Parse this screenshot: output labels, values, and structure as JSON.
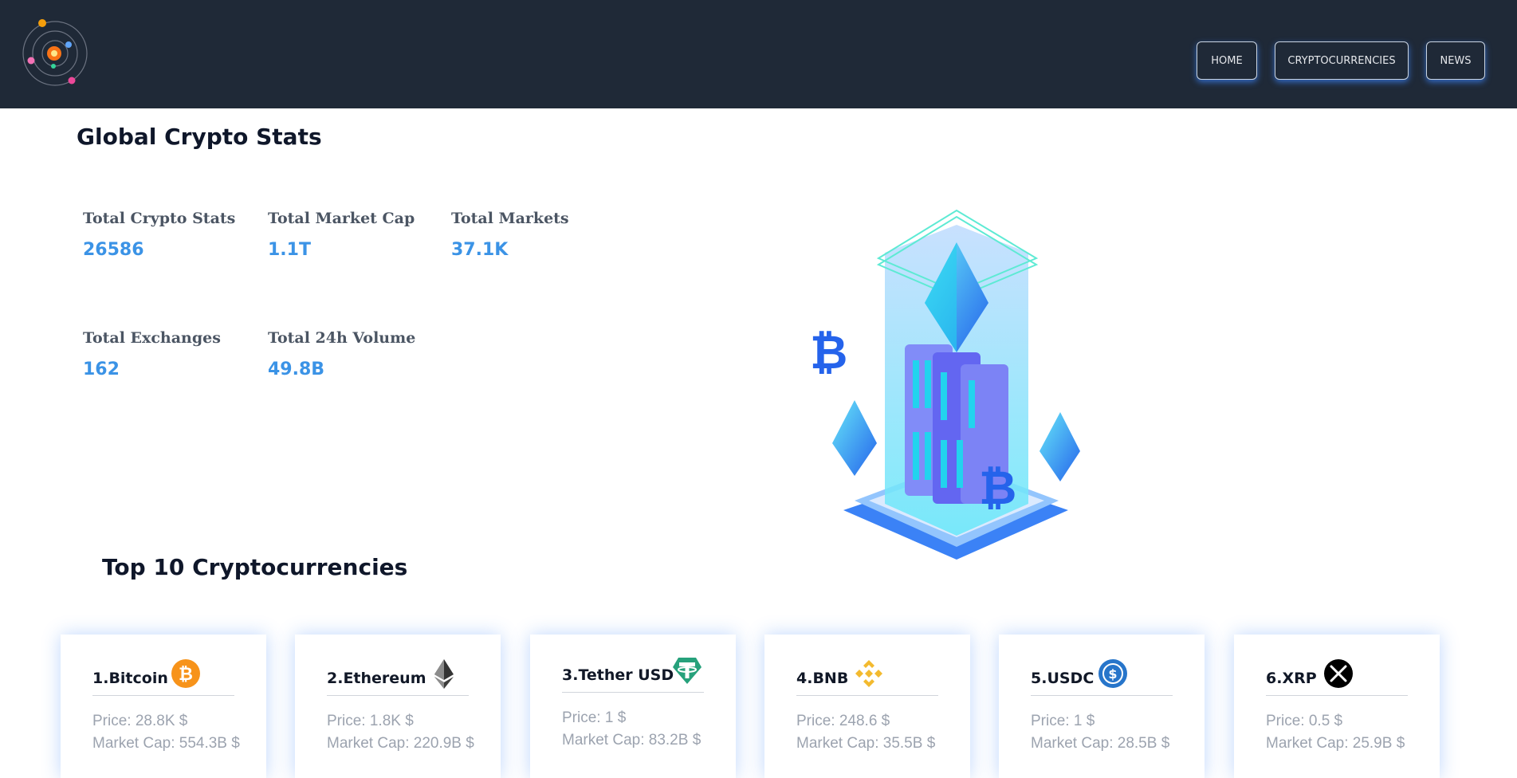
{
  "nav": {
    "home": "HOME",
    "cryptocurrencies": "CRYPTOCURRENCIES",
    "news": "NEWS"
  },
  "global_stats": {
    "title": "Global Crypto Stats",
    "items": [
      {
        "label": "Total Crypto Stats",
        "value": "26586"
      },
      {
        "label": "Total Market Cap",
        "value": "1.1T"
      },
      {
        "label": "Total Markets",
        "value": "37.1K"
      },
      {
        "label": "Total Exchanges",
        "value": "162"
      },
      {
        "label": "Total 24h Volume",
        "value": "49.8B"
      }
    ]
  },
  "top10": {
    "title": "Top 10 Cryptocurrencies",
    "cards": [
      {
        "name": "1.Bitcoin",
        "icon": "bitcoin-icon",
        "price": "Price: 28.8K $",
        "market_cap": "Market Cap: 554.3B $"
      },
      {
        "name": "2.Ethereum",
        "icon": "ethereum-icon",
        "price": "Price: 1.8K $",
        "market_cap": "Market Cap: 220.9B $"
      },
      {
        "name": "3.Tether USD",
        "icon": "tether-icon",
        "price": "Price: 1 $",
        "market_cap": "Market Cap: 83.2B $"
      },
      {
        "name": "4.BNB",
        "icon": "bnb-icon",
        "price": "Price: 248.6 $",
        "market_cap": "Market Cap: 35.5B $"
      },
      {
        "name": "5.USDC",
        "icon": "usdc-icon",
        "price": "Price: 1 $",
        "market_cap": "Market Cap: 28.5B $"
      },
      {
        "name": "6.XRP",
        "icon": "xrp-icon",
        "price": "Price: 0.5 $",
        "market_cap": "Market Cap: 25.9B $"
      }
    ]
  },
  "colors": {
    "header_bg": "#1f2937",
    "accent": "#3b93e6",
    "bitcoin": "#f7931a",
    "tether": "#26a17b",
    "bnb": "#f3ba2f",
    "usdc": "#2775ca",
    "xrp": "#000000"
  }
}
